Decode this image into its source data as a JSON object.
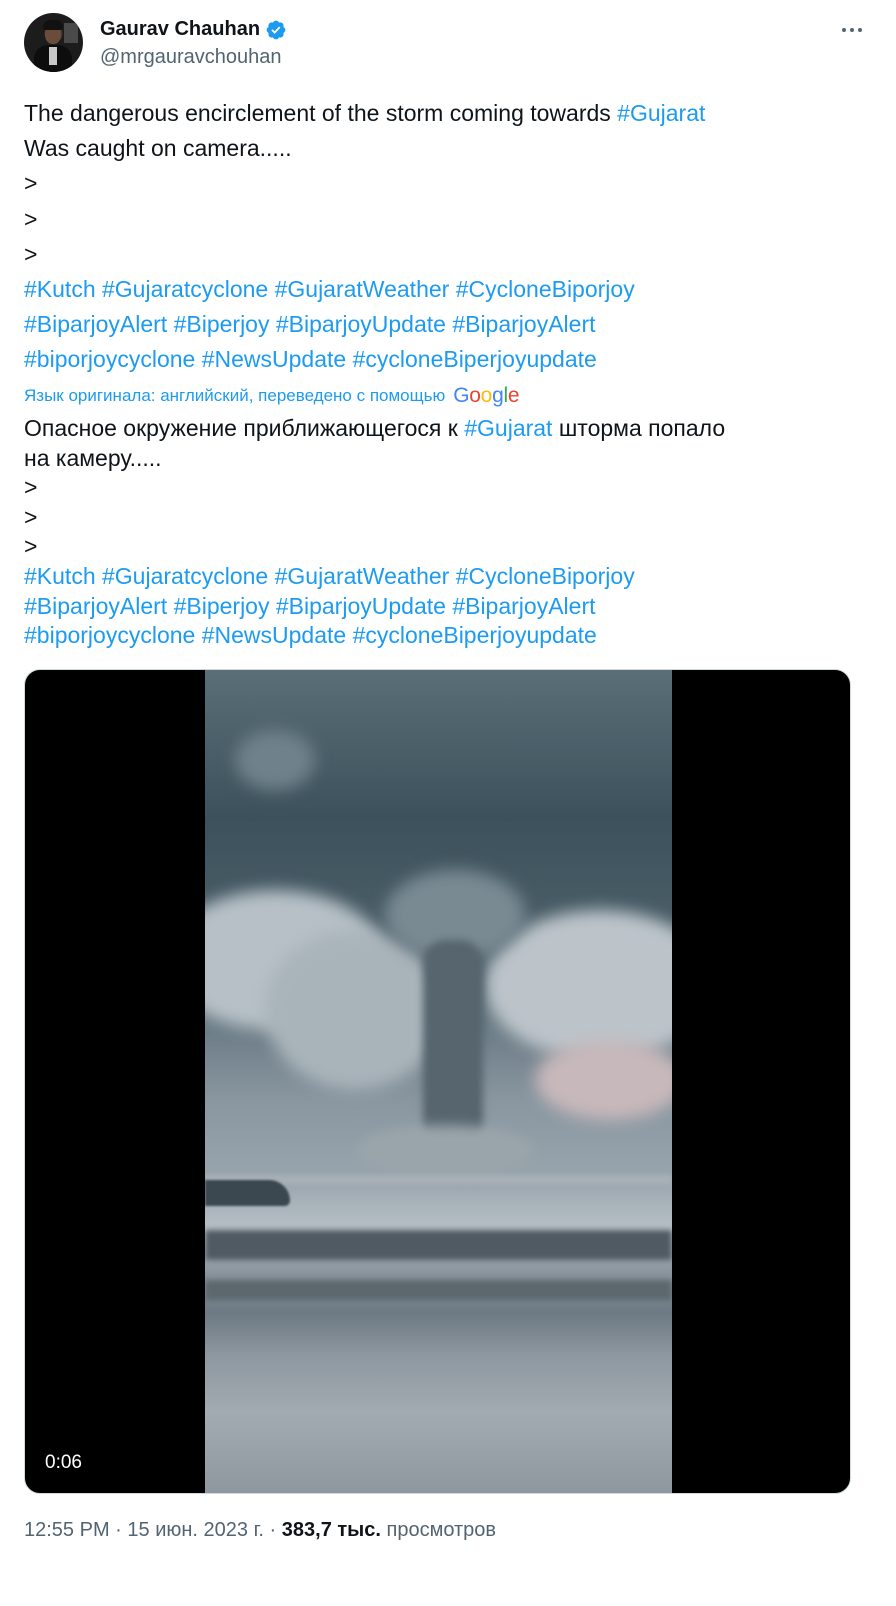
{
  "author": {
    "name": "Gaurav Chauhan",
    "handle": "@mrgauravchouhan",
    "verified": true,
    "avatar_icon": "avatar-photo"
  },
  "more_icon": "more-horizontal-icon",
  "original": {
    "line1_text": "The dangerous encirclement of the storm coming towards ",
    "line1_tag": "#Gujarat",
    "line2": "Was caught on camera.....",
    "arrows": [
      ">",
      ">",
      ">"
    ],
    "tags_line1": [
      "#Kutch",
      "#Gujaratcyclone",
      "#GujaratWeather",
      "#CycloneBiporjoy"
    ],
    "tags_line2": [
      "#BiparjoyAlert",
      "#Biperjoy",
      "#BiparjoyUpdate",
      "#BiparjoyAlert"
    ],
    "tags_line3": [
      "#biporjoycyclone",
      "#NewsUpdate",
      "#cycloneBiperjoyupdate"
    ]
  },
  "translation_note": {
    "text": "Язык оригинала: английский, переведено с помощью",
    "provider": "Google"
  },
  "translated": {
    "line1_before": "Опасное окружение приближающегося к ",
    "line1_tag": "#Gujarat",
    "line1_after": " шторма попало",
    "line2": "на камеру.....",
    "arrows": [
      ">",
      ">",
      ">"
    ],
    "tags_line1": [
      "#Kutch",
      "#Gujaratcyclone",
      "#GujaratWeather",
      "#CycloneBiporjoy"
    ],
    "tags_line2": [
      "#BiparjoyAlert",
      "#Biperjoy",
      "#BiparjoyUpdate",
      "#BiparjoyAlert"
    ],
    "tags_line3": [
      "#biporjoycyclone",
      "#NewsUpdate",
      "#cycloneBiperjoyupdate"
    ]
  },
  "video": {
    "duration": "0:06"
  },
  "meta": {
    "time": "12:55 PM",
    "separator": " · ",
    "date": "15 июн. 2023 г.",
    "views_count": "383,7 тыс.",
    "views_label": " просмотров"
  },
  "colors": {
    "link": "#1d9bf0",
    "text": "#0f1419",
    "secondary": "#536471"
  }
}
